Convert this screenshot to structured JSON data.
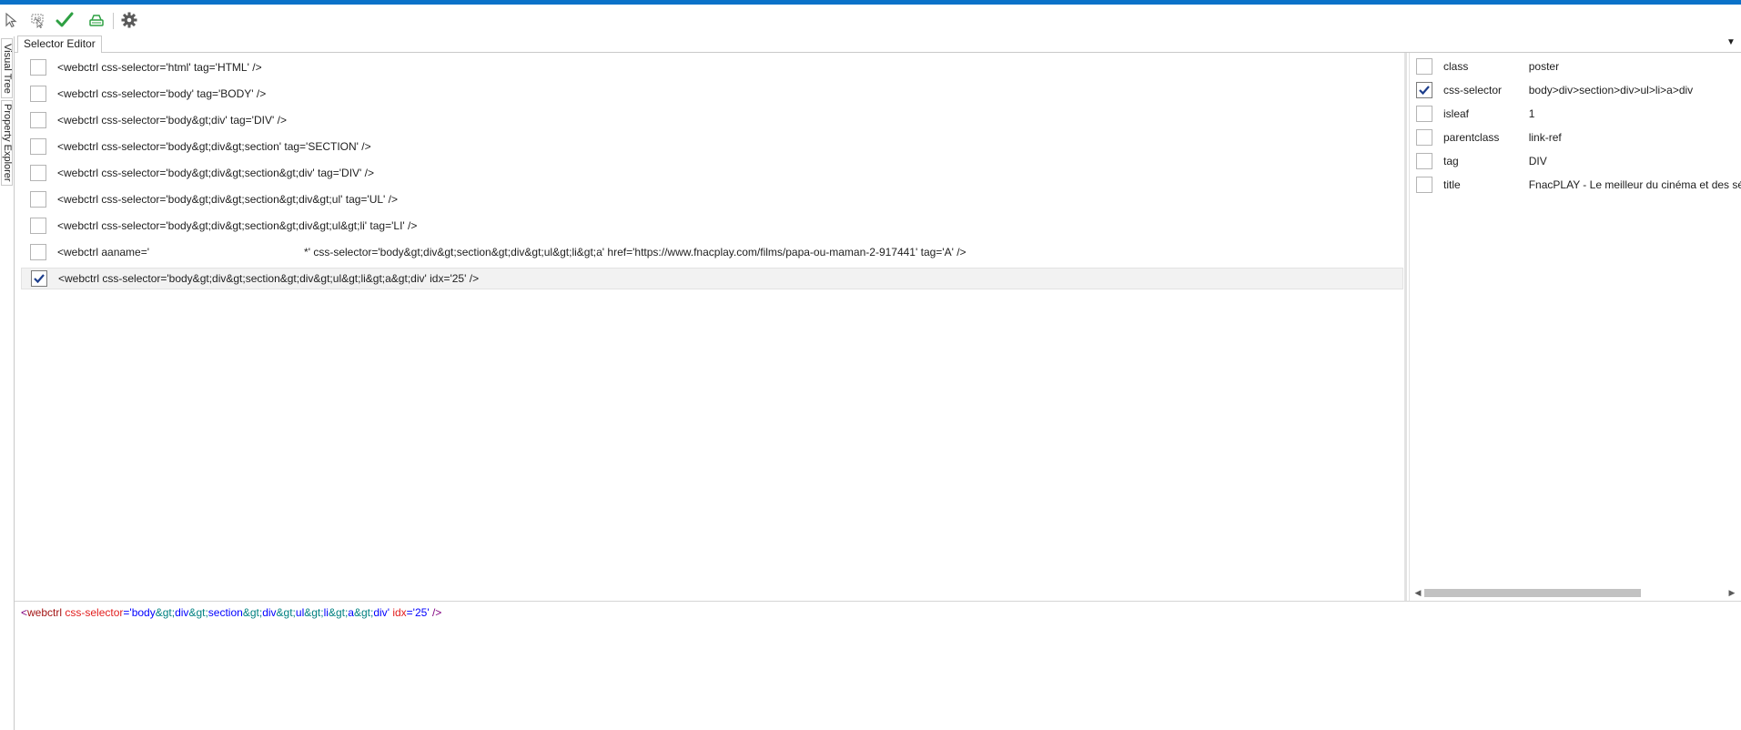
{
  "colors": {
    "accent_bar": "#0a72c9",
    "check_mark": "#1c3d8c",
    "selected_row_bg": "#f2f2f2",
    "ok_green": "#2ea043"
  },
  "toolbar": {
    "buttons": [
      {
        "name": "pointer-icon"
      },
      {
        "name": "text-select-icon"
      },
      {
        "name": "validate-check-icon"
      },
      {
        "name": "highlight-icon"
      },
      {
        "name": "settings-gear-icon"
      }
    ]
  },
  "tabs": {
    "active": "Selector Editor",
    "overflow": "▼"
  },
  "side_tabs": {
    "visual_tree": "Visual Tree",
    "property_explorer": "Property Explorer"
  },
  "selectors": [
    {
      "checked": false,
      "text": "<webctrl css-selector='html' tag='HTML' />"
    },
    {
      "checked": false,
      "text": "<webctrl css-selector='body' tag='BODY' />"
    },
    {
      "checked": false,
      "text": "<webctrl css-selector='body&gt;div' tag='DIV' />"
    },
    {
      "checked": false,
      "text": "<webctrl css-selector='body&gt;div&gt;section' tag='SECTION' />"
    },
    {
      "checked": false,
      "text": "<webctrl css-selector='body&gt;div&gt;section&gt;div' tag='DIV' />"
    },
    {
      "checked": false,
      "text": "<webctrl css-selector='body&gt;div&gt;section&gt;div&gt;ul' tag='UL' />"
    },
    {
      "checked": false,
      "text": "<webctrl css-selector='body&gt;div&gt;section&gt;div&gt;ul&gt;li' tag='LI' />"
    },
    {
      "checked": false,
      "text": "<webctrl aaname='                                                   *' css-selector='body&gt;div&gt;section&gt;div&gt;ul&gt;li&gt;a' href='https://www.fnacplay.com/films/papa-ou-maman-2-917441' tag='A' />"
    },
    {
      "checked": true,
      "text": "<webctrl css-selector='body&gt;div&gt;section&gt;div&gt;ul&gt;li&gt;a&gt;div' idx='25' />"
    }
  ],
  "properties": [
    {
      "checked": false,
      "name": "class",
      "value": "poster"
    },
    {
      "checked": true,
      "name": "css-selector",
      "value": "body>div>section>div>ul>li>a>div"
    },
    {
      "checked": false,
      "name": "isleaf",
      "value": "1"
    },
    {
      "checked": false,
      "name": "parentclass",
      "value": "link-ref"
    },
    {
      "checked": false,
      "name": "tag",
      "value": "DIV"
    },
    {
      "checked": false,
      "name": "title",
      "value": "FnacPLAY - Le meilleur du cinéma et des séries"
    }
  ],
  "scrollbar": {
    "left_arrow": "◀",
    "right_arrow": "▶"
  },
  "preview": {
    "tokens": [
      {
        "t": "<",
        "c": "tk-angle"
      },
      {
        "t": "webctrl",
        "c": "tk-tag"
      },
      {
        "t": " css-selector",
        "c": "tk-attr"
      },
      {
        "t": "='",
        "c": "tk-punct"
      },
      {
        "t": "body",
        "c": "tk-val"
      },
      {
        "t": "&gt;",
        "c": "tk-ent"
      },
      {
        "t": "div",
        "c": "tk-val"
      },
      {
        "t": "&gt;",
        "c": "tk-ent"
      },
      {
        "t": "section",
        "c": "tk-val"
      },
      {
        "t": "&gt;",
        "c": "tk-ent"
      },
      {
        "t": "div",
        "c": "tk-val"
      },
      {
        "t": "&gt;",
        "c": "tk-ent"
      },
      {
        "t": "ul",
        "c": "tk-val"
      },
      {
        "t": "&gt;",
        "c": "tk-ent"
      },
      {
        "t": "li",
        "c": "tk-val"
      },
      {
        "t": "&gt;",
        "c": "tk-ent"
      },
      {
        "t": "a",
        "c": "tk-val"
      },
      {
        "t": "&gt;",
        "c": "tk-ent"
      },
      {
        "t": "div",
        "c": "tk-val"
      },
      {
        "t": "'",
        "c": "tk-punct"
      },
      {
        "t": " idx",
        "c": "tk-attr"
      },
      {
        "t": "='",
        "c": "tk-punct"
      },
      {
        "t": "25",
        "c": "tk-val"
      },
      {
        "t": "'",
        "c": "tk-punct"
      },
      {
        "t": " />",
        "c": "tk-angle"
      }
    ]
  }
}
